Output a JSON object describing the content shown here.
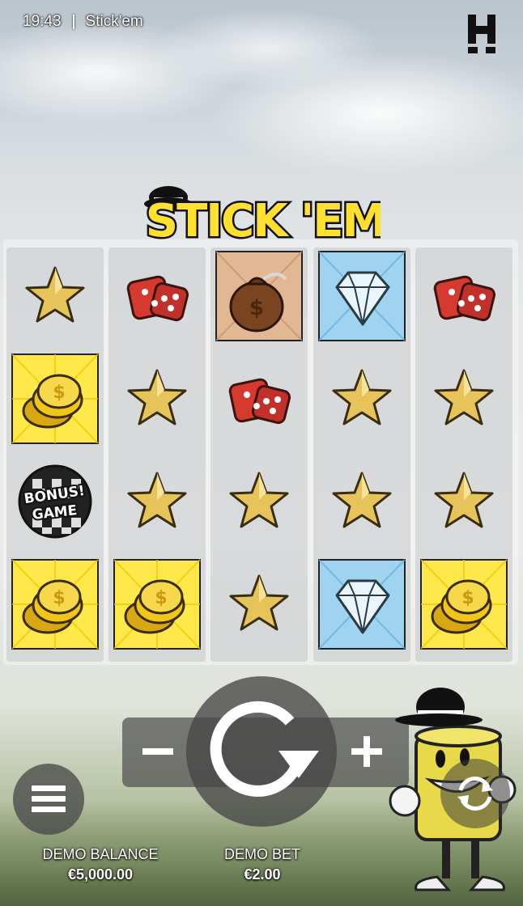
{
  "status_bar": {
    "time": "19:43",
    "game_name": "Stick'em"
  },
  "brand": {
    "logo_icon": "hacksaw-h-logo"
  },
  "game_logo": {
    "text": "STICK 'EM"
  },
  "reels": [
    [
      "star",
      "coins",
      "bonus-game",
      "coins"
    ],
    [
      "dice",
      "star",
      "star",
      "coins"
    ],
    [
      "money-bag",
      "dice",
      "star",
      "star"
    ],
    [
      "diamond",
      "star",
      "star",
      "diamond"
    ],
    [
      "dice",
      "star",
      "star",
      "coins"
    ]
  ],
  "bonus_symbol": {
    "line1": "BONUS",
    "line2": "GAME"
  },
  "controls": {
    "minus_icon": "minus-icon",
    "plus_icon": "plus-icon",
    "spin_icon": "spin-arrow-icon",
    "menu_icon": "hamburger-menu-icon",
    "autoplay_icon": "autoplay-icon"
  },
  "balance": {
    "label": "DEMO BALANCE",
    "value": "€5,000.00"
  },
  "bet": {
    "label": "DEMO BET",
    "value": "€2.00"
  },
  "colors": {
    "logo_yellow": "#ffe02e",
    "coin_gold": "#f2c618",
    "diamond_blue": "#9fd3f0",
    "dice_red": "#d6392e",
    "star_gold": "#e6c45a",
    "control_gray": "#555555"
  }
}
